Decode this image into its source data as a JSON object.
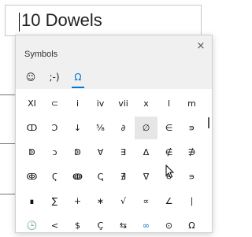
{
  "document": {
    "text": "10 Dowels"
  },
  "panel": {
    "title": "Symbols",
    "close_label": "×",
    "tabs": [
      {
        "label": "☺",
        "icon": "emoji-icon"
      },
      {
        "label": ";-)",
        "icon": "kaomoji-icon"
      },
      {
        "label": "Ω",
        "icon": "symbols-icon",
        "active": true
      }
    ],
    "rows": [
      [
        "XI",
        "⊂",
        "i",
        "iv",
        "vii",
        "x",
        "l",
        "m"
      ],
      [
        "ↀ",
        "Ↄ",
        "↓",
        "⁵⁄₈",
        "∂",
        "∅",
        "∈",
        "∍"
      ],
      [
        "ↁ",
        "ↄ",
        "ↁ",
        "∀",
        "∃",
        "Δ",
        "∉",
        "∌"
      ],
      [
        "ↂ",
        "Ϛ",
        "ↈ",
        "ↅ",
        "∄",
        "∇",
        "∊",
        "∍"
      ],
      [
        "∎",
        "∑",
        "∔",
        "∗",
        "√",
        "∝",
        "∠",
        "∣"
      ],
      [
        "🕒",
        "<",
        "$",
        "Ç",
        "⇆",
        "∞",
        "⊙",
        "Ω"
      ]
    ],
    "hover_cell": {
      "row": 1,
      "col": 5
    },
    "accent_color": "#0078d4"
  }
}
